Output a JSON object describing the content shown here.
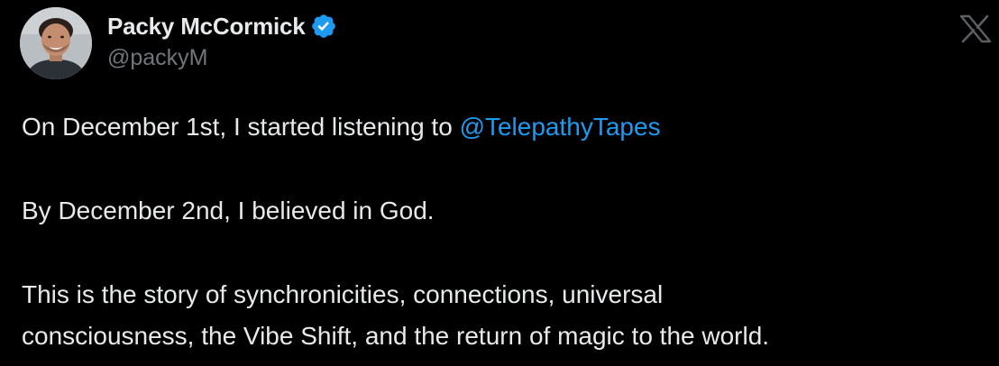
{
  "author": {
    "display_name": "Packy McCormick",
    "handle": "@packyM",
    "verified": true
  },
  "tweet": {
    "line1_prefix": "On December 1st, I started listening to ",
    "line1_mention": "@TelepathyTapes",
    "line2": "By December 2nd, I believed in God.",
    "line3a": "This is the story of synchronicities, connections, universal",
    "line3b": "consciousness, the Vibe Shift, and the return of magic to the world."
  },
  "icons": {
    "avatar": "profile-photo",
    "badge": "verified-checkmark-icon",
    "platform": "x-logo-icon"
  },
  "colors": {
    "background": "#000000",
    "text": "#e7e9ea",
    "secondary_text": "#71767b",
    "link": "#1d9bf0",
    "verified": "#1d9bf0"
  }
}
